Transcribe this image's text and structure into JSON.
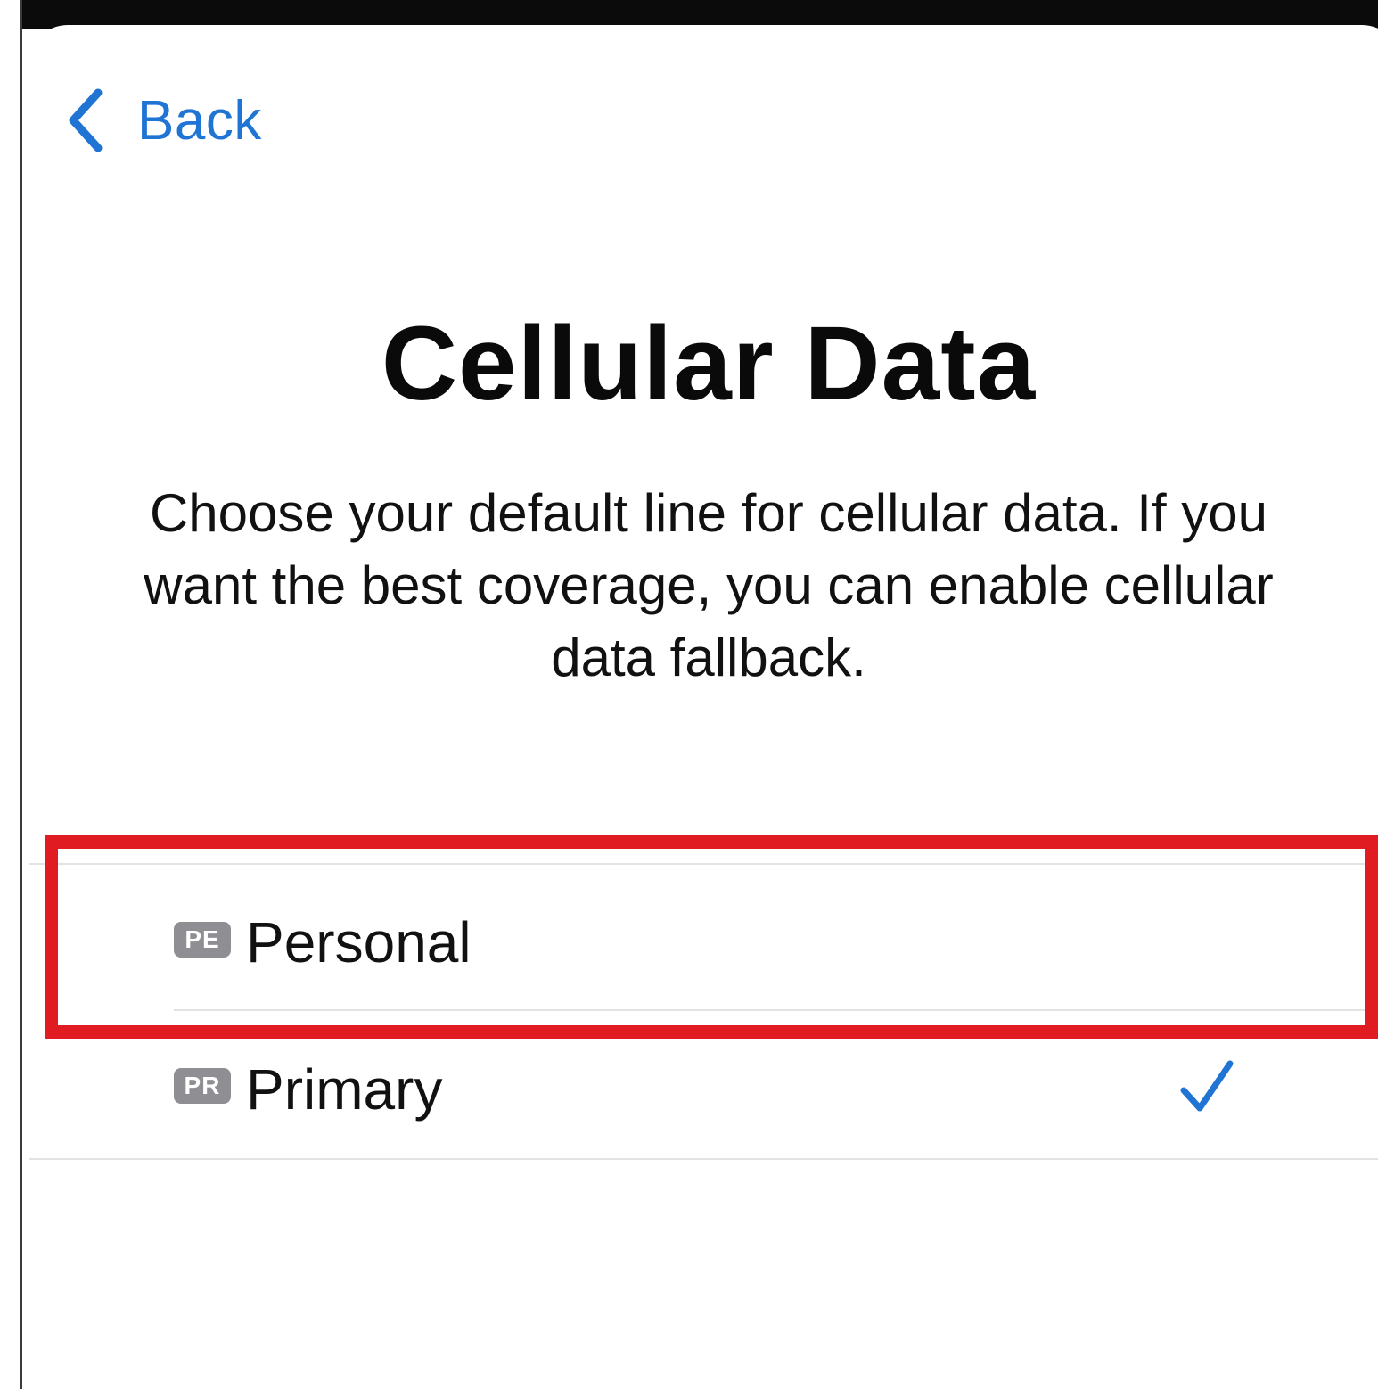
{
  "nav": {
    "back_label": "Back"
  },
  "page": {
    "title": "Cellular Data",
    "description": "Choose your default line for cellular data. If you want the best coverage, you can enable cellular data fallback."
  },
  "lines": [
    {
      "badge": "PE",
      "label": "Personal",
      "selected": false,
      "highlighted": true
    },
    {
      "badge": "PR",
      "label": "Primary",
      "selected": true,
      "highlighted": false
    }
  ],
  "icons": {
    "back": "chevron-left-icon",
    "selected": "checkmark-icon"
  },
  "colors": {
    "accent": "#1f74d4",
    "highlight": "#e01b22",
    "badge": "#8e8e93",
    "text": "#111111"
  }
}
